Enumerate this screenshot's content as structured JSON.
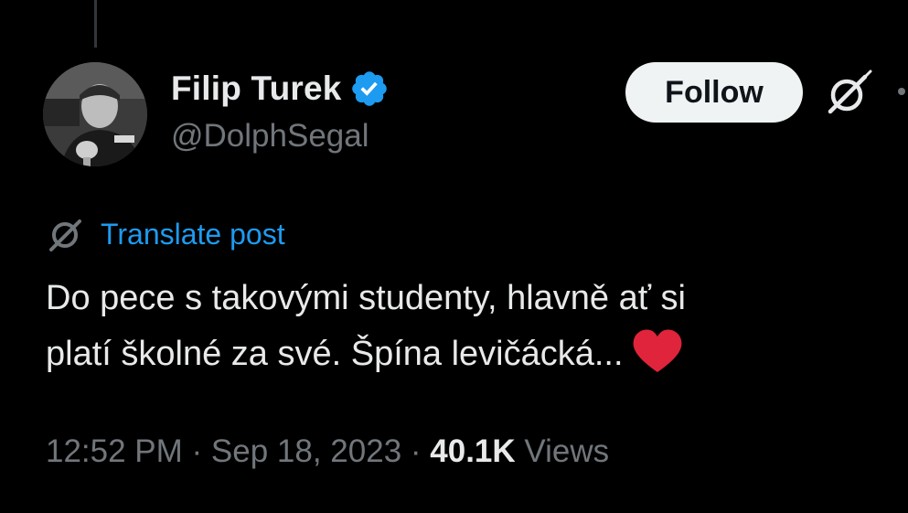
{
  "author": {
    "display_name": "Filip Turek",
    "handle": "@DolphSegal",
    "verified": true,
    "verified_color": "#1d9bf0"
  },
  "actions": {
    "follow_label": "Follow",
    "grok_icon": "grok-icon",
    "more_icon": "more-icon"
  },
  "translate": {
    "icon": "grok-icon",
    "label": "Translate post"
  },
  "post": {
    "line1": "Do pece s takovými studenty, hlavně ať si",
    "line2": "platí školné za své. Špína levičácká...",
    "emoji": "red-heart"
  },
  "meta": {
    "time": "12:52 PM",
    "separator": " · ",
    "date": "Sep 18, 2023",
    "views_count": "40.1K",
    "views_label": "Views"
  },
  "colors": {
    "background": "#000000",
    "text_primary": "#e7e9ea",
    "text_secondary": "#71767b",
    "link": "#1d9bf0",
    "heart": "#f91880"
  }
}
